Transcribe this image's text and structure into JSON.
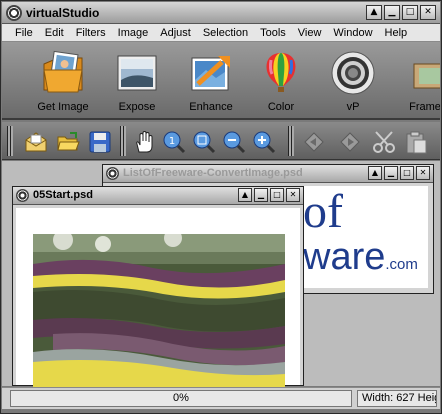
{
  "app": {
    "title": "virtualStudio"
  },
  "window_controls": [
    "▲",
    "▁",
    "□",
    "✕"
  ],
  "menu": [
    "File",
    "Edit",
    "Filters",
    "Image",
    "Adjust",
    "Selection",
    "Tools",
    "View",
    "Window",
    "Help"
  ],
  "big_toolbar": [
    {
      "label": "Get Image",
      "icon": "get-image-icon"
    },
    {
      "label": "Expose",
      "icon": "expose-icon"
    },
    {
      "label": "Enhance",
      "icon": "enhance-icon"
    },
    {
      "label": "Color",
      "icon": "color-balloon-icon"
    },
    {
      "label": "vP",
      "icon": "vp-disc-icon"
    },
    {
      "label": "Frame",
      "icon": "frame-icon"
    }
  ],
  "small_toolbar": [
    "open-mail-icon",
    "open-folder-icon",
    "save-icon",
    "hand-icon",
    "zoom-actual-icon",
    "zoom-fit-icon",
    "zoom-out-icon",
    "zoom-in-icon",
    "undo-icon",
    "redo-icon",
    "cut-icon",
    "paste-icon"
  ],
  "documents": {
    "back": {
      "title": "ListOfFreeware-ConvertImage.psd",
      "content_text_1": "of",
      "content_text_2": "ware",
      "content_text_3": ".com"
    },
    "front": {
      "title": "05Start.psd"
    }
  },
  "status": {
    "progress": "0%",
    "dimensions": "Width: 627  Heig"
  },
  "colors": {
    "accent_blue": "#1f3c8c",
    "accent_red": "#c8232c",
    "flower_yellow": "#e6d84a"
  }
}
